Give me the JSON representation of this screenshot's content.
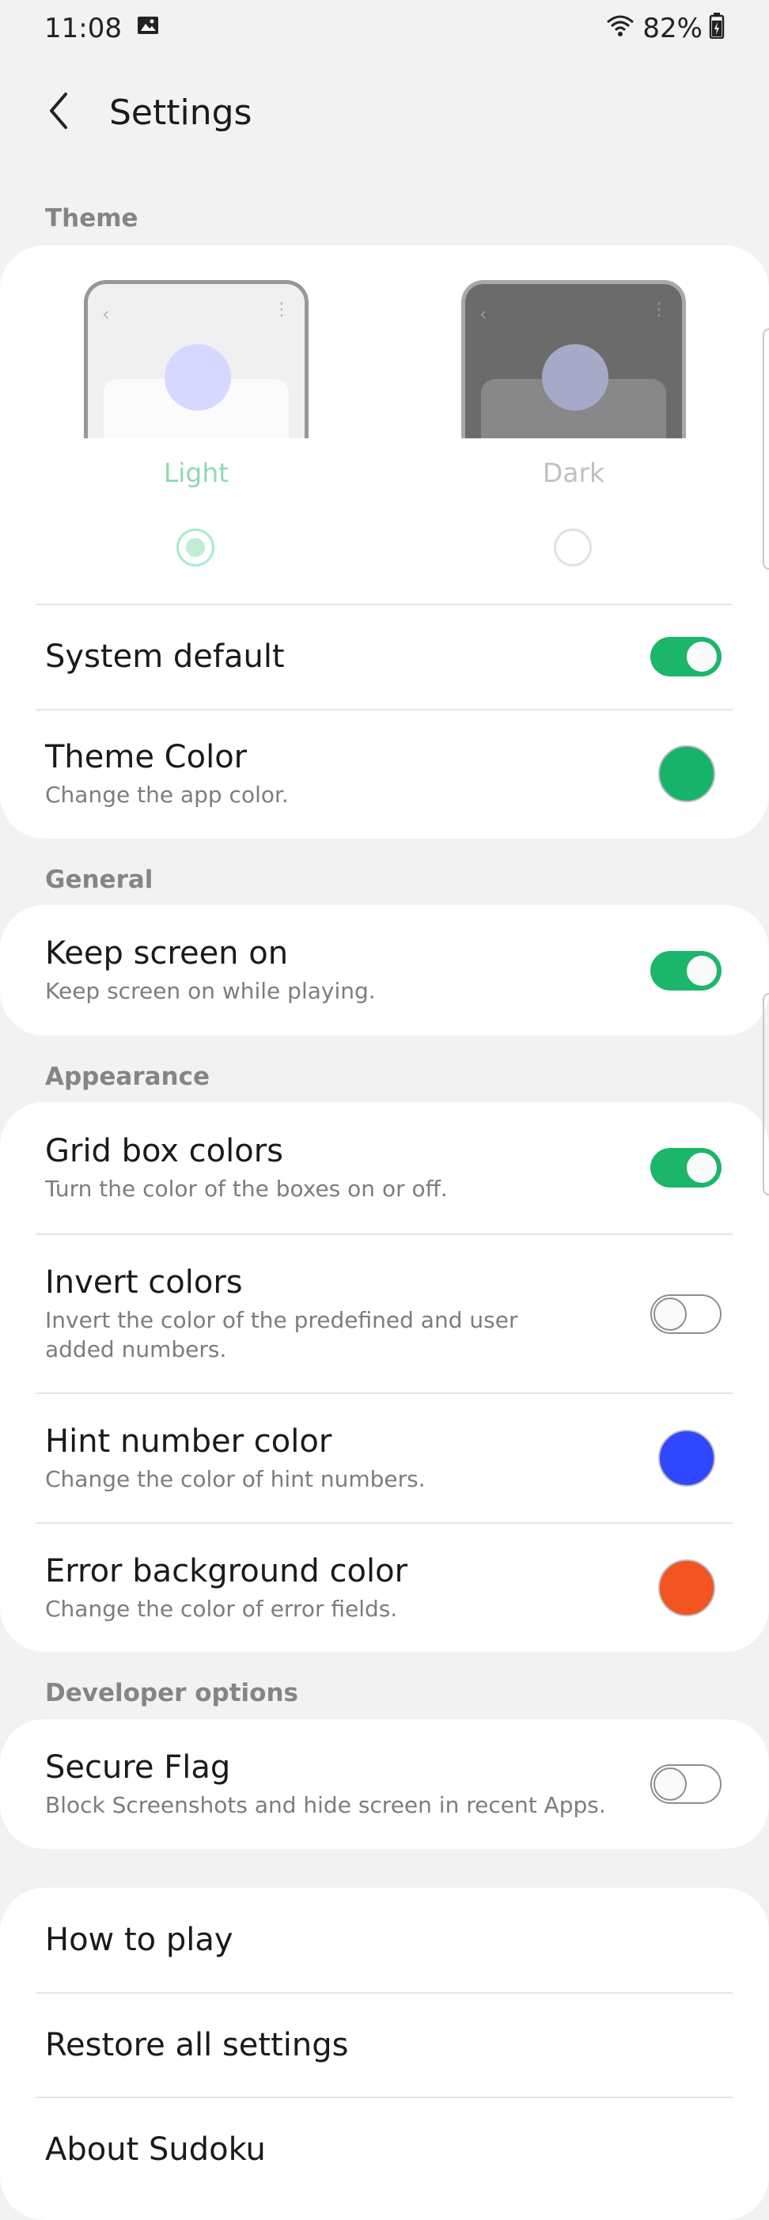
{
  "status_bar": {
    "time": "11:08",
    "battery": "82%"
  },
  "header": {
    "title": "Settings"
  },
  "theme_section": {
    "header": "Theme",
    "options": [
      {
        "label": "Light",
        "selected": true
      },
      {
        "label": "Dark",
        "selected": false
      }
    ],
    "system_default": {
      "title": "System default",
      "on": true
    },
    "theme_color": {
      "title": "Theme Color",
      "subtitle": "Change the app color.",
      "color": "#17b36a"
    }
  },
  "general_section": {
    "header": "General",
    "keep_screen_on": {
      "title": "Keep screen on",
      "subtitle": "Keep screen on while playing.",
      "on": true
    }
  },
  "appearance_section": {
    "header": "Appearance",
    "grid_box_colors": {
      "title": "Grid box colors",
      "subtitle": "Turn the color of the boxes on or off.",
      "on": true
    },
    "invert_colors": {
      "title": "Invert colors",
      "subtitle": "Invert the color of the predefined and user added numbers.",
      "on": false
    },
    "hint_number_color": {
      "title": "Hint number color",
      "subtitle": "Change the color of hint numbers.",
      "color": "#2f48ff"
    },
    "error_background_color": {
      "title": "Error background color",
      "subtitle": "Change the color of error fields.",
      "color": "#f25422"
    }
  },
  "developer_section": {
    "header": "Developer options",
    "secure_flag": {
      "title": "Secure Flag",
      "subtitle": "Block Screenshots and hide screen in recent Apps.",
      "on": false
    }
  },
  "other_section": {
    "how_to_play": "How to play",
    "restore_all_settings": "Restore all settings",
    "about": "About Sudoku"
  },
  "colors": {
    "accent": "#1cb66a",
    "background": "#f2f2f2"
  }
}
